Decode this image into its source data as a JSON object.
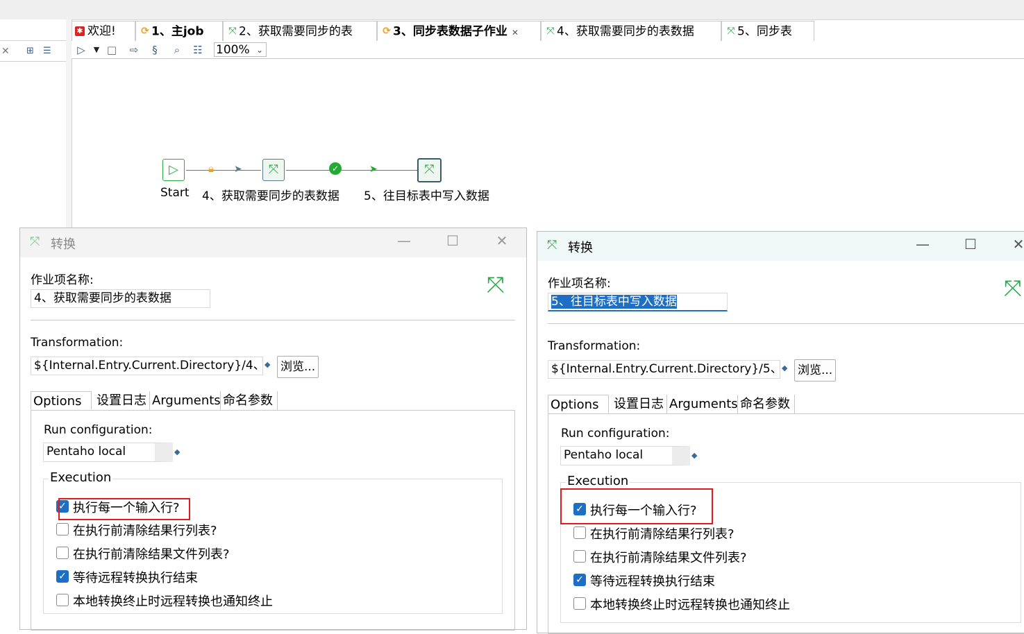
{
  "tabs": [
    {
      "label": "欢迎!",
      "icon": "welcome-icon",
      "active": false
    },
    {
      "label": "1、主job",
      "icon": "job-icon",
      "active": false
    },
    {
      "label": "2、获取需要同步的表",
      "icon": "transformation-icon",
      "active": false
    },
    {
      "label": "3、同步表数据子作业",
      "icon": "job-icon",
      "active": true
    },
    {
      "label": "4、获取需要同步的表数据",
      "icon": "transformation-icon",
      "active": false
    },
    {
      "label": "5、同步表",
      "icon": "transformation-icon",
      "active": false
    }
  ],
  "toolbar": {
    "zoom": "100%",
    "icons": [
      "run-icon",
      "run-dropdown-icon",
      "stop-icon",
      "replay-icon",
      "sql-icon",
      "explore-db-icon",
      "align-icon"
    ]
  },
  "canvas": {
    "nodes": [
      {
        "label": "Start",
        "icon": "start-icon"
      },
      {
        "label": "4、获取需要同步的表数据",
        "icon": "transformation-icon"
      },
      {
        "label": "5、往目标表中写入数据",
        "icon": "transformation-icon"
      }
    ],
    "hops": [
      {
        "icon": "lock-icon",
        "color": "#f0a020"
      },
      {
        "icon": "success-icon",
        "color": "#22aa33"
      }
    ]
  },
  "dialog_left": {
    "title": "转换",
    "name_label": "作业项名称:",
    "name_value": "4、获取需要同步的表数据",
    "transformation_label": "Transformation:",
    "transformation_value": "${Internal.Entry.Current.Directory}/4、",
    "browse_label": "浏览...",
    "tabs": [
      "Options",
      "设置日志",
      "Arguments",
      "命名参数"
    ],
    "run_config_label": "Run configuration:",
    "run_config_value": "Pentaho local",
    "execution_label": "Execution",
    "checkboxes": [
      {
        "label": "执行每一个输入行?",
        "checked": true
      },
      {
        "label": "在执行前清除结果行列表?",
        "checked": false
      },
      {
        "label": "在执行前清除结果文件列表?",
        "checked": false
      },
      {
        "label": "等待远程转换执行结束",
        "checked": true
      },
      {
        "label": "本地转换终止时远程转换也通知终止",
        "checked": false
      }
    ]
  },
  "dialog_right": {
    "title": "转换",
    "name_label": "作业项名称:",
    "name_value": "5、往目标表中写入数据",
    "transformation_label": "Transformation:",
    "transformation_value": "${Internal.Entry.Current.Directory}/5、",
    "browse_label": "浏览...",
    "tabs": [
      "Options",
      "设置日志",
      "Arguments",
      "命名参数"
    ],
    "run_config_label": "Run configuration:",
    "run_config_value": "Pentaho local",
    "execution_label": "Execution",
    "checkboxes": [
      {
        "label": "执行每一个输入行?",
        "checked": true
      },
      {
        "label": "在执行前清除结果行列表?",
        "checked": false
      },
      {
        "label": "在执行前清除结果文件列表?",
        "checked": false
      },
      {
        "label": "等待远程转换执行结束",
        "checked": true
      },
      {
        "label": "本地转换终止时远程转换也通知终止",
        "checked": false
      }
    ]
  },
  "colors": {
    "accent": "#1e6fc3",
    "highlight": "#e01b1b",
    "transformation": "#2aa84a",
    "job": "#f0a020"
  }
}
